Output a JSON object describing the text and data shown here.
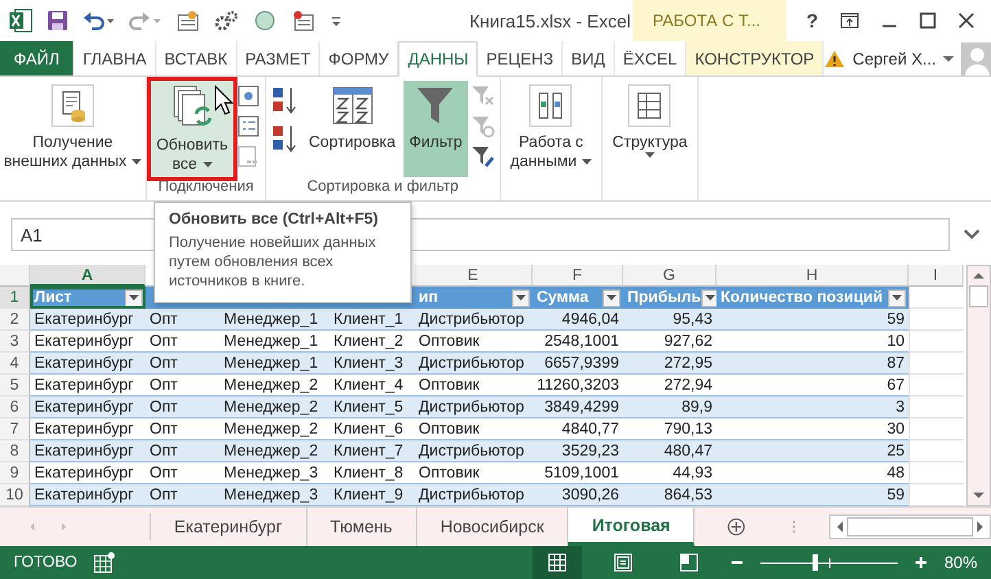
{
  "window": {
    "title": "Книга15.xlsx - Excel",
    "context_group": "РАБОТА С Т...",
    "help": "?"
  },
  "ribbon_tabs": [
    {
      "label": "ФАЙЛ",
      "kind": "file",
      "selected": false
    },
    {
      "label": "ГЛАВНА",
      "kind": "normal",
      "selected": false
    },
    {
      "label": "ВСТАВК",
      "kind": "normal",
      "selected": false
    },
    {
      "label": "РАЗМЕТ",
      "kind": "normal",
      "selected": false
    },
    {
      "label": "ФОРМУ",
      "kind": "normal",
      "selected": false
    },
    {
      "label": "ДАННЫ",
      "kind": "normal",
      "selected": true
    },
    {
      "label": "РЕЦЕНЗ",
      "kind": "normal",
      "selected": false
    },
    {
      "label": "ВИД",
      "kind": "normal",
      "selected": false
    },
    {
      "label": "ЁXCEL",
      "kind": "normal",
      "selected": false
    },
    {
      "label": "КОНСТРУКТОР",
      "kind": "contextual",
      "selected": false
    }
  ],
  "account": {
    "name": "Сергей Х..."
  },
  "ribbon": {
    "get_data": {
      "lines": [
        "Получение",
        "внешних данных"
      ]
    },
    "refresh": {
      "lines": [
        "Обновить",
        "все"
      ],
      "highlighted": true
    },
    "connections_label": "Подключения",
    "sort": {
      "label": "Сортировка"
    },
    "filter": {
      "label": "Фильтр",
      "on": true
    },
    "sort_filter_label": "Сортировка и фильтр",
    "data_tools": {
      "lines": [
        "Работа с",
        "данными"
      ]
    },
    "outline": {
      "lines": [
        "Структура"
      ]
    }
  },
  "name_box": {
    "value": "A1"
  },
  "tooltip": {
    "title": "Обновить все (Ctrl+Alt+F5)",
    "text": "Получение новейших данных путем обновления всех источников в книге."
  },
  "sheet": {
    "columns": [
      {
        "label": "A",
        "selected": true
      },
      {},
      {},
      {},
      {
        "label": "E",
        "selected": false
      },
      {
        "label": "F",
        "selected": false
      },
      {
        "label": "G",
        "selected": false
      },
      {
        "label": "H",
        "selected": false
      },
      {
        "label": "I",
        "selected": false
      }
    ],
    "header_row": {
      "num": "1",
      "selected": true,
      "cells": [
        {
          "text": "Лист",
          "selected": true
        },
        {},
        {},
        {},
        {
          "text": "ип",
          "selected": false
        },
        {
          "text": "Сумма",
          "selected": false
        },
        {
          "text": "Прибыль",
          "selected": false
        },
        {
          "text": "Количество позиций",
          "selected": false
        }
      ]
    },
    "rows": [
      {
        "num": "2",
        "cells": [
          "Екатеринбург",
          "Опт",
          "Менеджер_1",
          "Клиент_1",
          "Дистрибьютор",
          "4946,04",
          "95,43",
          "59"
        ]
      },
      {
        "num": "3",
        "cells": [
          "Екатеринбург",
          "Опт",
          "Менеджер_1",
          "Клиент_2",
          "Оптовик",
          "2548,1001",
          "927,62",
          "10"
        ]
      },
      {
        "num": "4",
        "cells": [
          "Екатеринбург",
          "Опт",
          "Менеджер_1",
          "Клиент_3",
          "Дистрибьютор",
          "6657,9399",
          "272,95",
          "87"
        ]
      },
      {
        "num": "5",
        "cells": [
          "Екатеринбург",
          "Опт",
          "Менеджер_2",
          "Клиент_4",
          "Оптовик",
          "11260,3203",
          "272,94",
          "67"
        ]
      },
      {
        "num": "6",
        "cells": [
          "Екатеринбург",
          "Опт",
          "Менеджер_2",
          "Клиент_5",
          "Дистрибьютор",
          "3849,4299",
          "89,9",
          "3"
        ]
      },
      {
        "num": "7",
        "cells": [
          "Екатеринбург",
          "Опт",
          "Менеджер_2",
          "Клиент_6",
          "Оптовик",
          "4840,77",
          "790,13",
          "30"
        ]
      },
      {
        "num": "8",
        "cells": [
          "Екатеринбург",
          "Опт",
          "Менеджер_2",
          "Клиент_7",
          "Дистрибьютор",
          "3529,23",
          "480,47",
          "25"
        ]
      },
      {
        "num": "9",
        "cells": [
          "Екатеринбург",
          "Опт",
          "Менеджер_3",
          "Клиент_8",
          "Оптовик",
          "5109,1001",
          "44,93",
          "48"
        ]
      },
      {
        "num": "10",
        "cells": [
          "Екатеринбург",
          "Опт",
          "Менеджер_3",
          "Клиент_9",
          "Дистрибьютор",
          "3090,26",
          "864,53",
          "59"
        ]
      }
    ]
  },
  "sheet_tabs": [
    {
      "label": "Екатеринбург",
      "selected": false
    },
    {
      "label": "Тюмень",
      "selected": false
    },
    {
      "label": "Новосибирск",
      "selected": false
    },
    {
      "label": "Итоговая",
      "selected": true
    }
  ],
  "status_bar": {
    "text": "ГОТОВО",
    "views": [
      {
        "kind": "normal",
        "selected": true
      },
      {
        "kind": "layout",
        "selected": false
      },
      {
        "kind": "breaks",
        "selected": false
      }
    ],
    "zoom": {
      "level": 0.4,
      "reading": "80%"
    }
  }
}
